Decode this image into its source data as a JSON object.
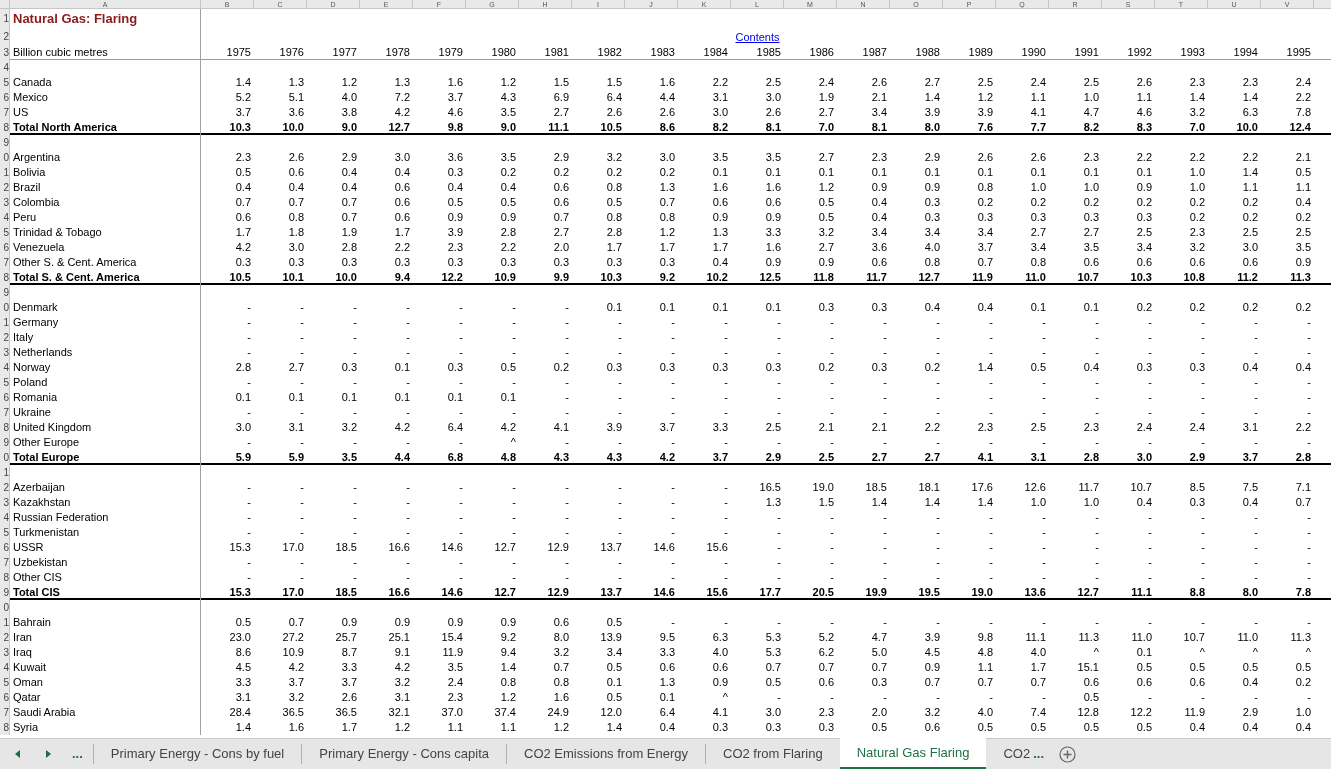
{
  "column_letters": [
    "A",
    "B",
    "C",
    "D",
    "E",
    "F",
    "G",
    "H",
    "I",
    "J",
    "K",
    "L",
    "M",
    "N",
    "O",
    "P",
    "Q",
    "R",
    "S",
    "T",
    "U",
    "V"
  ],
  "rows": [
    {
      "row": "1",
      "kind": "title",
      "label": "Natural Gas: Flaring"
    },
    {
      "row": "2",
      "kind": "link",
      "link": "Contents"
    },
    {
      "row": "3",
      "kind": "years",
      "label": "Billion cubic metres",
      "values": [
        "1975",
        "1976",
        "1977",
        "1978",
        "1979",
        "1980",
        "1981",
        "1982",
        "1983",
        "1984",
        "1985",
        "1986",
        "1987",
        "1988",
        "1989",
        "1990",
        "1991",
        "1992",
        "1993",
        "1994",
        "1995"
      ]
    },
    {
      "row": "4",
      "kind": "blank"
    },
    {
      "row": "5",
      "kind": "country",
      "label": "Canada",
      "values": [
        "1.4",
        "1.3",
        "1.2",
        "1.3",
        "1.6",
        "1.2",
        "1.5",
        "1.5",
        "1.6",
        "2.2",
        "2.5",
        "2.4",
        "2.6",
        "2.7",
        "2.5",
        "2.4",
        "2.5",
        "2.6",
        "2.3",
        "2.3",
        "2.4"
      ]
    },
    {
      "row": "6",
      "kind": "country",
      "label": "Mexico",
      "values": [
        "5.2",
        "5.1",
        "4.0",
        "7.2",
        "3.7",
        "4.3",
        "6.9",
        "6.4",
        "4.4",
        "3.1",
        "3.0",
        "1.9",
        "2.1",
        "1.4",
        "1.2",
        "1.1",
        "1.0",
        "1.1",
        "1.4",
        "1.4",
        "2.2"
      ]
    },
    {
      "row": "7",
      "kind": "country",
      "label": "US",
      "values": [
        "3.7",
        "3.6",
        "3.8",
        "4.2",
        "4.6",
        "3.5",
        "2.7",
        "2.6",
        "2.6",
        "3.0",
        "2.6",
        "2.7",
        "3.4",
        "3.9",
        "3.9",
        "4.1",
        "4.7",
        "4.6",
        "3.2",
        "6.3",
        "7.8"
      ]
    },
    {
      "row": "8",
      "kind": "total",
      "label": "Total North America",
      "values": [
        "10.3",
        "10.0",
        "9.0",
        "12.7",
        "9.8",
        "9.0",
        "11.1",
        "10.5",
        "8.6",
        "8.2",
        "8.1",
        "7.0",
        "8.1",
        "8.0",
        "7.6",
        "7.7",
        "8.2",
        "8.3",
        "7.0",
        "10.0",
        "12.4"
      ]
    },
    {
      "row": "9",
      "kind": "blank"
    },
    {
      "row": "0",
      "kind": "country",
      "label": "Argentina",
      "values": [
        "2.3",
        "2.6",
        "2.9",
        "3.0",
        "3.6",
        "3.5",
        "2.9",
        "3.2",
        "3.0",
        "3.5",
        "3.5",
        "2.7",
        "2.3",
        "2.9",
        "2.6",
        "2.6",
        "2.3",
        "2.2",
        "2.2",
        "2.2",
        "2.1"
      ]
    },
    {
      "row": "1",
      "kind": "country",
      "label": "Bolivia",
      "values": [
        "0.5",
        "0.6",
        "0.4",
        "0.4",
        "0.3",
        "0.2",
        "0.2",
        "0.2",
        "0.2",
        "0.1",
        "0.1",
        "0.1",
        "0.1",
        "0.1",
        "0.1",
        "0.1",
        "0.1",
        "0.1",
        "1.0",
        "1.4",
        "0.5"
      ]
    },
    {
      "row": "2",
      "kind": "country",
      "label": "Brazil",
      "values": [
        "0.4",
        "0.4",
        "0.4",
        "0.6",
        "0.4",
        "0.4",
        "0.6",
        "0.8",
        "1.3",
        "1.6",
        "1.6",
        "1.2",
        "0.9",
        "0.9",
        "0.8",
        "1.0",
        "1.0",
        "0.9",
        "1.0",
        "1.1",
        "1.1"
      ]
    },
    {
      "row": "3",
      "kind": "country",
      "label": "Colombia",
      "values": [
        "0.7",
        "0.7",
        "0.7",
        "0.6",
        "0.5",
        "0.5",
        "0.6",
        "0.5",
        "0.7",
        "0.6",
        "0.6",
        "0.5",
        "0.4",
        "0.3",
        "0.2",
        "0.2",
        "0.2",
        "0.2",
        "0.2",
        "0.2",
        "0.4"
      ]
    },
    {
      "row": "4",
      "kind": "country",
      "label": "Peru",
      "values": [
        "0.6",
        "0.8",
        "0.7",
        "0.6",
        "0.9",
        "0.9",
        "0.7",
        "0.8",
        "0.8",
        "0.9",
        "0.9",
        "0.5",
        "0.4",
        "0.3",
        "0.3",
        "0.3",
        "0.3",
        "0.3",
        "0.2",
        "0.2",
        "0.2"
      ]
    },
    {
      "row": "5",
      "kind": "country",
      "label": "Trinidad & Tobago",
      "values": [
        "1.7",
        "1.8",
        "1.9",
        "1.7",
        "3.9",
        "2.8",
        "2.7",
        "2.8",
        "1.2",
        "1.3",
        "3.3",
        "3.2",
        "3.4",
        "3.4",
        "3.4",
        "2.7",
        "2.7",
        "2.5",
        "2.3",
        "2.5",
        "2.5"
      ]
    },
    {
      "row": "6",
      "kind": "country",
      "label": "Venezuela",
      "values": [
        "4.2",
        "3.0",
        "2.8",
        "2.2",
        "2.3",
        "2.2",
        "2.0",
        "1.7",
        "1.7",
        "1.7",
        "1.6",
        "2.7",
        "3.6",
        "4.0",
        "3.7",
        "3.4",
        "3.5",
        "3.4",
        "3.2",
        "3.0",
        "3.5"
      ]
    },
    {
      "row": "7",
      "kind": "country",
      "label": "Other S. & Cent. America",
      "values": [
        "0.3",
        "0.3",
        "0.3",
        "0.3",
        "0.3",
        "0.3",
        "0.3",
        "0.3",
        "0.3",
        "0.4",
        "0.9",
        "0.9",
        "0.6",
        "0.8",
        "0.7",
        "0.8",
        "0.6",
        "0.6",
        "0.6",
        "0.6",
        "0.9"
      ]
    },
    {
      "row": "8",
      "kind": "total",
      "label": "Total S. & Cent. America",
      "values": [
        "10.5",
        "10.1",
        "10.0",
        "9.4",
        "12.2",
        "10.9",
        "9.9",
        "10.3",
        "9.2",
        "10.2",
        "12.5",
        "11.8",
        "11.7",
        "12.7",
        "11.9",
        "11.0",
        "10.7",
        "10.3",
        "10.8",
        "11.2",
        "11.3"
      ]
    },
    {
      "row": "9",
      "kind": "blank"
    },
    {
      "row": "0",
      "kind": "country",
      "label": "Denmark",
      "values": [
        "-",
        "-",
        "-",
        "-",
        "-",
        "-",
        "-",
        "0.1",
        "0.1",
        "0.1",
        "0.1",
        "0.3",
        "0.3",
        "0.4",
        "0.4",
        "0.1",
        "0.1",
        "0.2",
        "0.2",
        "0.2",
        "0.2"
      ]
    },
    {
      "row": "1",
      "kind": "country",
      "label": "Germany",
      "values": [
        "-",
        "-",
        "-",
        "-",
        "-",
        "-",
        "-",
        "-",
        "-",
        "-",
        "-",
        "-",
        "-",
        "-",
        "-",
        "-",
        "-",
        "-",
        "-",
        "-",
        "-"
      ]
    },
    {
      "row": "2",
      "kind": "country",
      "label": "Italy",
      "values": [
        "-",
        "-",
        "-",
        "-",
        "-",
        "-",
        "-",
        "-",
        "-",
        "-",
        "-",
        "-",
        "-",
        "-",
        "-",
        "-",
        "-",
        "-",
        "-",
        "-",
        "-"
      ]
    },
    {
      "row": "3",
      "kind": "country",
      "label": "Netherlands",
      "values": [
        "-",
        "-",
        "-",
        "-",
        "-",
        "-",
        "-",
        "-",
        "-",
        "-",
        "-",
        "-",
        "-",
        "-",
        "-",
        "-",
        "-",
        "-",
        "-",
        "-",
        "-"
      ]
    },
    {
      "row": "4",
      "kind": "country",
      "label": "Norway",
      "values": [
        "2.8",
        "2.7",
        "0.3",
        "0.1",
        "0.3",
        "0.5",
        "0.2",
        "0.3",
        "0.3",
        "0.3",
        "0.3",
        "0.2",
        "0.3",
        "0.2",
        "1.4",
        "0.5",
        "0.4",
        "0.3",
        "0.3",
        "0.4",
        "0.4"
      ]
    },
    {
      "row": "5",
      "kind": "country",
      "label": "Poland",
      "values": [
        "-",
        "-",
        "-",
        "-",
        "-",
        "-",
        "-",
        "-",
        "-",
        "-",
        "-",
        "-",
        "-",
        "-",
        "-",
        "-",
        "-",
        "-",
        "-",
        "-",
        "-"
      ]
    },
    {
      "row": "6",
      "kind": "country",
      "label": "Romania",
      "values": [
        "0.1",
        "0.1",
        "0.1",
        "0.1",
        "0.1",
        "0.1",
        "-",
        "-",
        "-",
        "-",
        "-",
        "-",
        "-",
        "-",
        "-",
        "-",
        "-",
        "-",
        "-",
        "-",
        "-"
      ]
    },
    {
      "row": "7",
      "kind": "country",
      "label": "Ukraine",
      "values": [
        "-",
        "-",
        "-",
        "-",
        "-",
        "-",
        "-",
        "-",
        "-",
        "-",
        "-",
        "-",
        "-",
        "-",
        "-",
        "-",
        "-",
        "-",
        "-",
        "-",
        "-"
      ]
    },
    {
      "row": "8",
      "kind": "country",
      "label": "United Kingdom",
      "values": [
        "3.0",
        "3.1",
        "3.2",
        "4.2",
        "6.4",
        "4.2",
        "4.1",
        "3.9",
        "3.7",
        "3.3",
        "2.5",
        "2.1",
        "2.1",
        "2.2",
        "2.3",
        "2.5",
        "2.3",
        "2.4",
        "2.4",
        "3.1",
        "2.2"
      ]
    },
    {
      "row": "9",
      "kind": "country",
      "label": "Other Europe",
      "values": [
        "-",
        "-",
        "-",
        "-",
        "-",
        "^",
        "-",
        "-",
        "-",
        "-",
        "-",
        "-",
        "-",
        "-",
        "-",
        "-",
        "-",
        "-",
        "-",
        "-",
        "-"
      ]
    },
    {
      "row": "0",
      "kind": "total",
      "label": "Total Europe",
      "values": [
        "5.9",
        "5.9",
        "3.5",
        "4.4",
        "6.8",
        "4.8",
        "4.3",
        "4.3",
        "4.2",
        "3.7",
        "2.9",
        "2.5",
        "2.7",
        "2.7",
        "4.1",
        "3.1",
        "2.8",
        "3.0",
        "2.9",
        "3.7",
        "2.8"
      ]
    },
    {
      "row": "1",
      "kind": "blank"
    },
    {
      "row": "2",
      "kind": "country",
      "label": "Azerbaijan",
      "values": [
        "-",
        "-",
        "-",
        "-",
        "-",
        "-",
        "-",
        "-",
        "-",
        "-",
        "16.5",
        "19.0",
        "18.5",
        "18.1",
        "17.6",
        "12.6",
        "11.7",
        "10.7",
        "8.5",
        "7.5",
        "7.1"
      ]
    },
    {
      "row": "3",
      "kind": "country",
      "label": "Kazakhstan",
      "values": [
        "-",
        "-",
        "-",
        "-",
        "-",
        "-",
        "-",
        "-",
        "-",
        "-",
        "1.3",
        "1.5",
        "1.4",
        "1.4",
        "1.4",
        "1.0",
        "1.0",
        "0.4",
        "0.3",
        "0.4",
        "0.7"
      ]
    },
    {
      "row": "4",
      "kind": "country",
      "label": "Russian Federation",
      "values": [
        "-",
        "-",
        "-",
        "-",
        "-",
        "-",
        "-",
        "-",
        "-",
        "-",
        "-",
        "-",
        "-",
        "-",
        "-",
        "-",
        "-",
        "-",
        "-",
        "-",
        "-"
      ]
    },
    {
      "row": "5",
      "kind": "country",
      "label": "Turkmenistan",
      "values": [
        "-",
        "-",
        "-",
        "-",
        "-",
        "-",
        "-",
        "-",
        "-",
        "-",
        "-",
        "-",
        "-",
        "-",
        "-",
        "-",
        "-",
        "-",
        "-",
        "-",
        "-"
      ]
    },
    {
      "row": "6",
      "kind": "country",
      "label": "USSR",
      "values": [
        "15.3",
        "17.0",
        "18.5",
        "16.6",
        "14.6",
        "12.7",
        "12.9",
        "13.7",
        "14.6",
        "15.6",
        "-",
        "-",
        "-",
        "-",
        "-",
        "-",
        "-",
        "-",
        "-",
        "-",
        "-"
      ]
    },
    {
      "row": "7",
      "kind": "country",
      "label": "Uzbekistan",
      "values": [
        "-",
        "-",
        "-",
        "-",
        "-",
        "-",
        "-",
        "-",
        "-",
        "-",
        "-",
        "-",
        "-",
        "-",
        "-",
        "-",
        "-",
        "-",
        "-",
        "-",
        "-"
      ]
    },
    {
      "row": "8",
      "kind": "country",
      "label": "Other CIS",
      "values": [
        "-",
        "-",
        "-",
        "-",
        "-",
        "-",
        "-",
        "-",
        "-",
        "-",
        "-",
        "-",
        "-",
        "-",
        "-",
        "-",
        "-",
        "-",
        "-",
        "-",
        "-"
      ]
    },
    {
      "row": "9",
      "kind": "total",
      "label": "Total CIS",
      "values": [
        "15.3",
        "17.0",
        "18.5",
        "16.6",
        "14.6",
        "12.7",
        "12.9",
        "13.7",
        "14.6",
        "15.6",
        "17.7",
        "20.5",
        "19.9",
        "19.5",
        "19.0",
        "13.6",
        "12.7",
        "11.1",
        "8.8",
        "8.0",
        "7.8"
      ]
    },
    {
      "row": "0",
      "kind": "blank"
    },
    {
      "row": "1",
      "kind": "country",
      "label": "Bahrain",
      "values": [
        "0.5",
        "0.7",
        "0.9",
        "0.9",
        "0.9",
        "0.9",
        "0.6",
        "0.5",
        "-",
        "-",
        "-",
        "-",
        "-",
        "-",
        "-",
        "-",
        "-",
        "-",
        "-",
        "-",
        "-"
      ]
    },
    {
      "row": "2",
      "kind": "country",
      "label": "Iran",
      "values": [
        "23.0",
        "27.2",
        "25.7",
        "25.1",
        "15.4",
        "9.2",
        "8.0",
        "13.9",
        "9.5",
        "6.3",
        "5.3",
        "5.2",
        "4.7",
        "3.9",
        "9.8",
        "11.1",
        "11.3",
        "11.0",
        "10.7",
        "11.0",
        "11.3"
      ]
    },
    {
      "row": "3",
      "kind": "country",
      "label": "Iraq",
      "values": [
        "8.6",
        "10.9",
        "8.7",
        "9.1",
        "11.9",
        "9.4",
        "3.2",
        "3.4",
        "3.3",
        "4.0",
        "5.3",
        "6.2",
        "5.0",
        "4.5",
        "4.8",
        "4.0",
        "^",
        "0.1",
        "^",
        "^",
        "^"
      ]
    },
    {
      "row": "4",
      "kind": "country",
      "label": "Kuwait",
      "values": [
        "4.5",
        "4.2",
        "3.3",
        "4.2",
        "3.5",
        "1.4",
        "0.7",
        "0.5",
        "0.6",
        "0.6",
        "0.7",
        "0.7",
        "0.7",
        "0.9",
        "1.1",
        "1.7",
        "15.1",
        "0.5",
        "0.5",
        "0.5",
        "0.5"
      ]
    },
    {
      "row": "5",
      "kind": "country",
      "label": "Oman",
      "values": [
        "3.3",
        "3.7",
        "3.7",
        "3.2",
        "2.4",
        "0.8",
        "0.8",
        "0.1",
        "1.3",
        "0.9",
        "0.5",
        "0.6",
        "0.3",
        "0.7",
        "0.7",
        "0.7",
        "0.6",
        "0.6",
        "0.6",
        "0.4",
        "0.2"
      ]
    },
    {
      "row": "6",
      "kind": "country",
      "label": "Qatar",
      "values": [
        "3.1",
        "3.2",
        "2.6",
        "3.1",
        "2.3",
        "1.2",
        "1.6",
        "0.5",
        "0.1",
        "^",
        "-",
        "-",
        "-",
        "-",
        "-",
        "-",
        "0.5",
        "-",
        "-",
        "-",
        "-"
      ]
    },
    {
      "row": "7",
      "kind": "country",
      "label": "Saudi Arabia",
      "values": [
        "28.4",
        "36.5",
        "36.5",
        "32.1",
        "37.0",
        "37.4",
        "24.9",
        "12.0",
        "6.4",
        "4.1",
        "3.0",
        "2.3",
        "2.0",
        "3.2",
        "4.0",
        "7.4",
        "12.8",
        "12.2",
        "11.9",
        "2.9",
        "1.0"
      ]
    },
    {
      "row": "8",
      "kind": "country",
      "label": "Syria",
      "values": [
        "1.4",
        "1.6",
        "1.7",
        "1.2",
        "1.1",
        "1.1",
        "1.2",
        "1.4",
        "0.4",
        "0.3",
        "0.3",
        "0.3",
        "0.5",
        "0.6",
        "0.5",
        "0.5",
        "0.5",
        "0.5",
        "0.4",
        "0.4",
        "0.4"
      ]
    }
  ],
  "sheet_nav": {
    "more": "..."
  },
  "sheet_tabs": [
    {
      "label": "Primary Energy - Cons by fuel",
      "selected": false
    },
    {
      "label": "Primary Energy - Cons capita",
      "selected": false
    },
    {
      "label": "CO2 Emissions from Energy",
      "selected": false
    },
    {
      "label": "CO2 from Flaring",
      "selected": false
    },
    {
      "label": "Natural Gas Flaring",
      "selected": true
    },
    {
      "label": "CO2",
      "selected": false
    }
  ],
  "tabs_more": "..."
}
